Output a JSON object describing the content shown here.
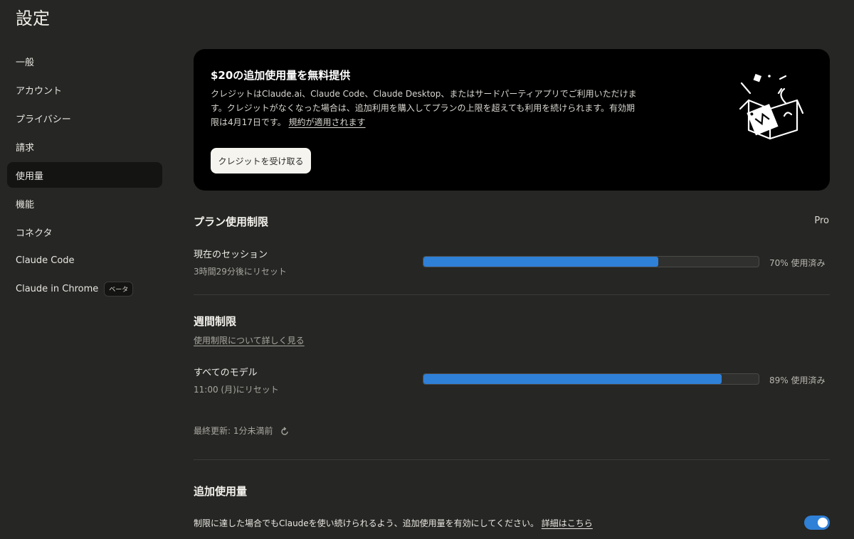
{
  "page": {
    "title": "設定"
  },
  "sidebar": {
    "items": [
      {
        "label": "一般"
      },
      {
        "label": "アカウント"
      },
      {
        "label": "プライバシー"
      },
      {
        "label": "請求"
      },
      {
        "label": "使用量",
        "active": true
      },
      {
        "label": "機能"
      },
      {
        "label": "コネクタ"
      },
      {
        "label": "Claude Code"
      },
      {
        "label": "Claude in Chrome",
        "badge": "ベータ"
      }
    ]
  },
  "promo": {
    "title": "$20の追加使用量を無料提供",
    "text": "クレジットはClaude.ai、Claude Code、Claude Desktop、またはサードパーティアプリでご利用いただけます。クレジットがなくなった場合は、追加利用を購入してプランの上限を超えても利用を続けられます。有効期限は4月17日です。",
    "link": "規約が適用されます",
    "button": "クレジットを受け取る",
    "illustration_icon": "gift-box-icon"
  },
  "plan": {
    "title": "プラン使用制限",
    "badge": "Pro",
    "session": {
      "label": "現在のセッション",
      "reset": "3時間29分後にリセット",
      "percent": 70,
      "percent_label": "70% 使用済み"
    }
  },
  "weekly": {
    "title": "週間制限",
    "link": "使用制限について詳しく見る",
    "all_models": {
      "label": "すべてのモデル",
      "reset": "11:00 (月)にリセット",
      "percent": 89,
      "percent_label": "89% 使用済み"
    },
    "last_updated": "最終更新: 1分未満前"
  },
  "extra": {
    "title": "追加使用量",
    "text": "制限に達した場合でもClaudeを使い続けられるよう、追加使用量を有効にしてください。",
    "link": "詳細はこちら",
    "enabled": true
  },
  "colors": {
    "accent": "#2f80d7",
    "background": "#262624",
    "card": "#000000"
  }
}
